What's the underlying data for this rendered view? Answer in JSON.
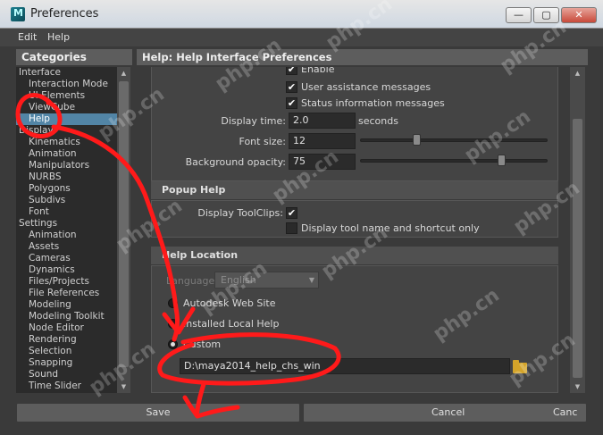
{
  "window": {
    "title": "Preferences",
    "buttons": {
      "minimize": "—",
      "maximize": "▢",
      "close": "✕"
    }
  },
  "menubar": {
    "items": [
      "Edit",
      "Help"
    ]
  },
  "categories": {
    "header": "Categories",
    "items": [
      {
        "label": "Interface",
        "level": 0
      },
      {
        "label": "Interaction Mode",
        "level": 1
      },
      {
        "label": "UI Elements",
        "level": 1
      },
      {
        "label": "ViewCube",
        "level": 1
      },
      {
        "label": "Help",
        "level": 1,
        "selected": true
      },
      {
        "label": "Display",
        "level": 0
      },
      {
        "label": "Kinematics",
        "level": 1
      },
      {
        "label": "Animation",
        "level": 1
      },
      {
        "label": "Manipulators",
        "level": 1
      },
      {
        "label": "NURBS",
        "level": 1
      },
      {
        "label": "Polygons",
        "level": 1
      },
      {
        "label": "Subdivs",
        "level": 1
      },
      {
        "label": "Font",
        "level": 1
      },
      {
        "label": "Settings",
        "level": 0
      },
      {
        "label": "Animation",
        "level": 1
      },
      {
        "label": "Assets",
        "level": 1
      },
      {
        "label": "Cameras",
        "level": 1
      },
      {
        "label": "Dynamics",
        "level": 1
      },
      {
        "label": "Files/Projects",
        "level": 1
      },
      {
        "label": "File References",
        "level": 1
      },
      {
        "label": "Modeling",
        "level": 1
      },
      {
        "label": "Modeling Toolkit",
        "level": 1
      },
      {
        "label": "Node Editor",
        "level": 1
      },
      {
        "label": "Rendering",
        "level": 1
      },
      {
        "label": "Selection",
        "level": 1
      },
      {
        "label": "Snapping",
        "level": 1
      },
      {
        "label": "Sound",
        "level": 1
      },
      {
        "label": "Time Slider",
        "level": 1
      }
    ]
  },
  "section": {
    "header": "Help: Help Interface Preferences",
    "tooltips": {
      "enable": "Enable",
      "user_assistance": "User assistance messages",
      "status_info": "Status information messages",
      "display_time_label": "Display time:",
      "display_time_value": "2.0",
      "display_time_unit": "seconds",
      "font_size_label": "Font size:",
      "font_size_value": "12",
      "font_size_slider": 0.3,
      "bg_opacity_label": "Background opacity:",
      "bg_opacity_value": "75",
      "bg_opacity_slider": 0.75
    },
    "popup_help": {
      "title": "Popup Help",
      "display_toolclips": "Display ToolClips:",
      "display_tool_name": "Display tool name and shortcut only"
    },
    "help_location": {
      "title": "Help Location",
      "language_label": "Language",
      "language_value": "English",
      "autodesk_web": "Autodesk Web Site",
      "installed_local": "Installed Local Help",
      "custom": "Custom",
      "custom_path": "D:\\maya2014_help_chs_win"
    }
  },
  "bottom": {
    "save": "Save",
    "cancel": "Cancel",
    "cancel_partial": "Canc"
  },
  "watermark": "php.cn",
  "colors": {
    "selection": "#5285a6",
    "annotation": "#ff1a1a"
  }
}
